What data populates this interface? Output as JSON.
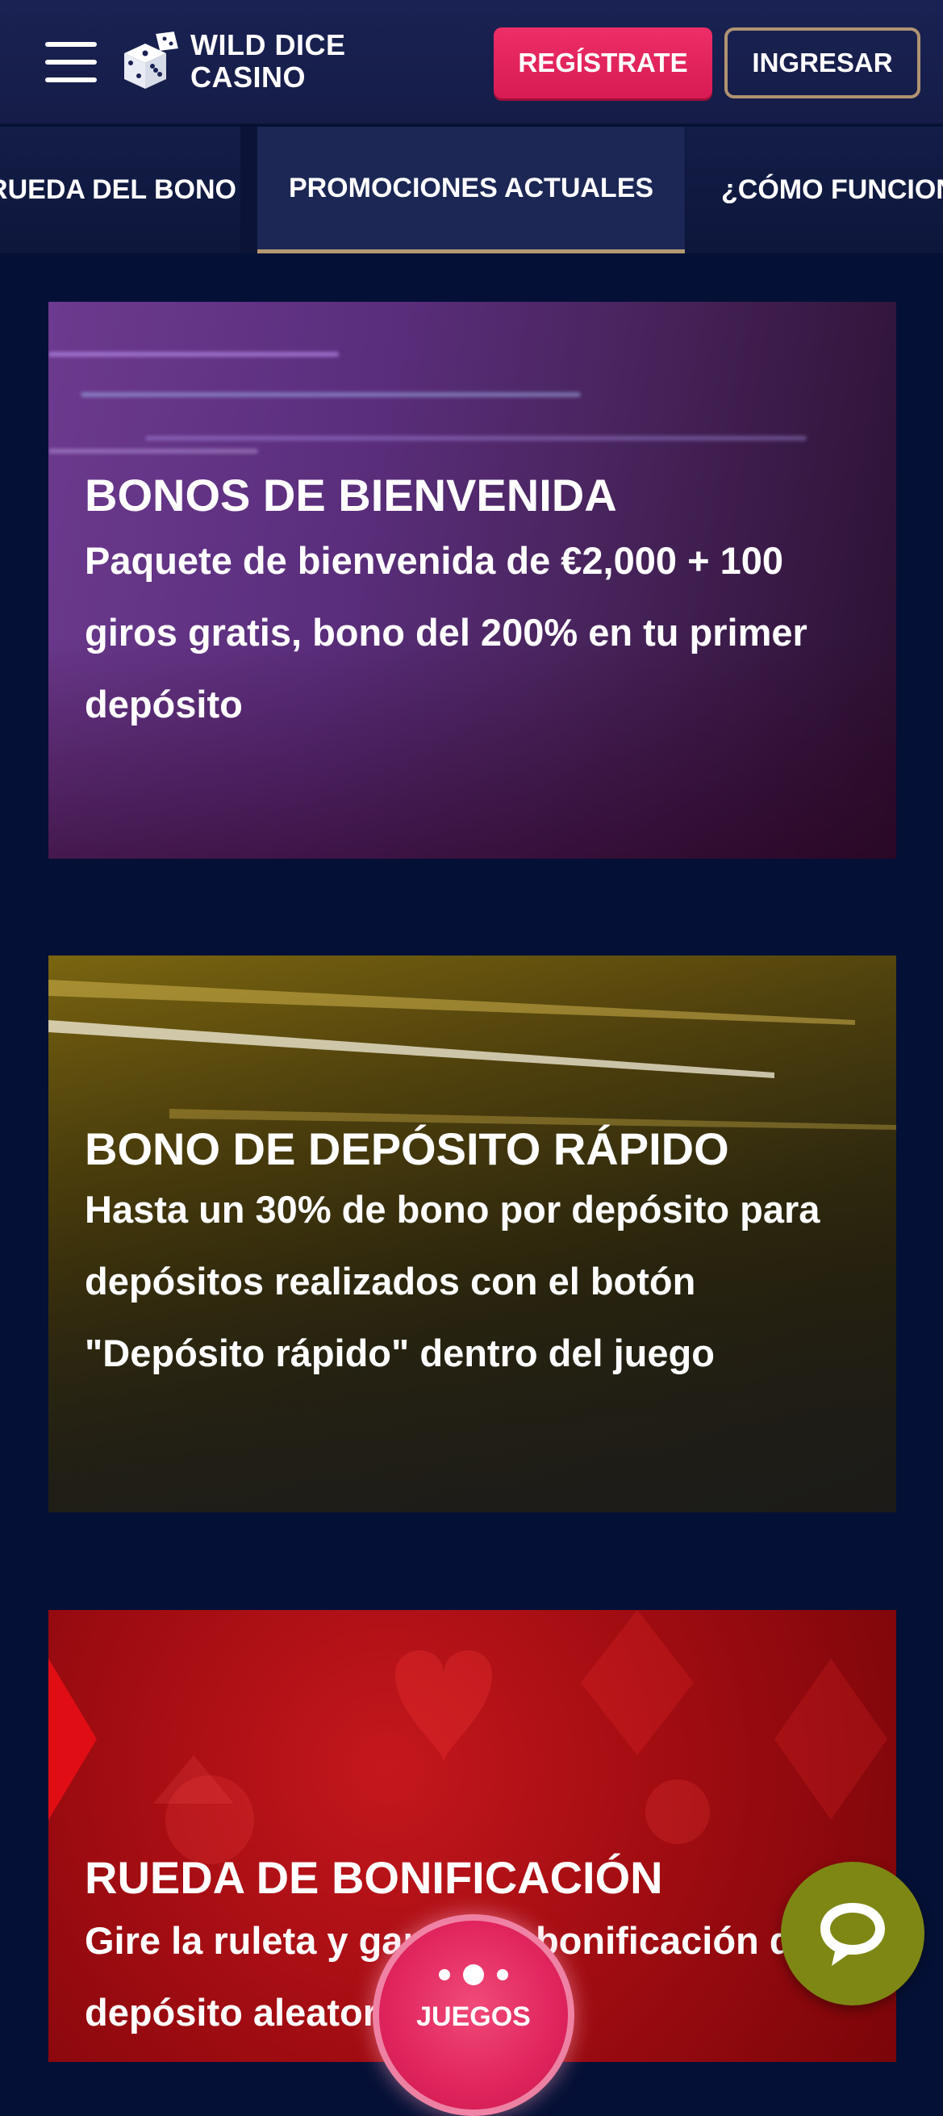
{
  "header": {
    "logo_line1": "WILD DICE",
    "logo_line2": "CASINO",
    "register_label": "REGÍSTRATE",
    "login_label": "INGRESAR"
  },
  "tabs": [
    {
      "label": "RUEDA DEL BONO"
    },
    {
      "label": "PROMOCIONES ACTUALES",
      "active": true
    },
    {
      "label": "¿CÓMO FUNCIONA"
    }
  ],
  "promotions": [
    {
      "title": "BONOS DE BIENVENIDA",
      "description": "Paquete de bienvenida de €2,000 + 100 giros gratis, bono del 200% en tu primer depósito"
    },
    {
      "title": "BONO DE DEPÓSITO RÁPIDO",
      "description": "Hasta un 30% de bono por depósito para depósitos realizados con el botón \"Depósito rápido\" dentro del juego"
    },
    {
      "title": "RUEDA DE BONIFICACIÓN",
      "description": "Gire la ruleta y gane una bonificación de depósito aleatoria"
    }
  ],
  "games_button": {
    "label": "JUEGOS"
  },
  "colors": {
    "background": "#051036",
    "header": "#1a2253",
    "register": "#e8245c",
    "login_border": "#b09372",
    "active_tab_underline": "#b39a72",
    "chat": "#7e8714"
  },
  "icons": [
    "menu-icon",
    "dice-logo-icon",
    "chat-bubble-icon",
    "games-dots-icon"
  ]
}
